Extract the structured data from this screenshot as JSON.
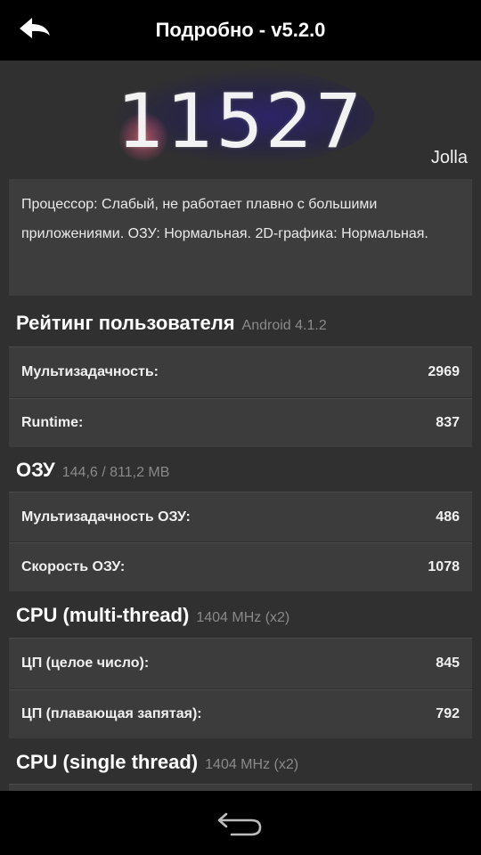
{
  "app_bar": {
    "title": "Подробно - v5.2.0",
    "back_icon": "back-arrow-icon"
  },
  "score": {
    "value": "11527",
    "device": "Jolla"
  },
  "description": "Процессор: Слабый, не работает плавно с большими приложениями. ОЗУ: Нормальная. 2D-графика: Нормальная.",
  "sections": [
    {
      "title": "Рейтинг пользователя",
      "subtitle": "Android 4.1.2",
      "rows": [
        {
          "label": "Мультизадачность:",
          "value": "2969"
        },
        {
          "label": "Runtime:",
          "value": "837"
        }
      ]
    },
    {
      "title": "ОЗУ",
      "subtitle": "144,6 / 811,2 MB",
      "rows": [
        {
          "label": "Мультизадачность ОЗУ:",
          "value": "486"
        },
        {
          "label": "Скорость ОЗУ:",
          "value": "1078"
        }
      ]
    },
    {
      "title": "CPU (multi-thread)",
      "subtitle": "1404 MHz (x2)",
      "rows": [
        {
          "label": "ЦП (целое число):",
          "value": "845"
        },
        {
          "label": "ЦП (плавающая запятая):",
          "value": "792"
        }
      ]
    },
    {
      "title": "CPU (single thread)",
      "subtitle": "1404 MHz (x2)",
      "rows": []
    }
  ],
  "nav_bar": {
    "back_icon": "nav-back-icon"
  }
}
